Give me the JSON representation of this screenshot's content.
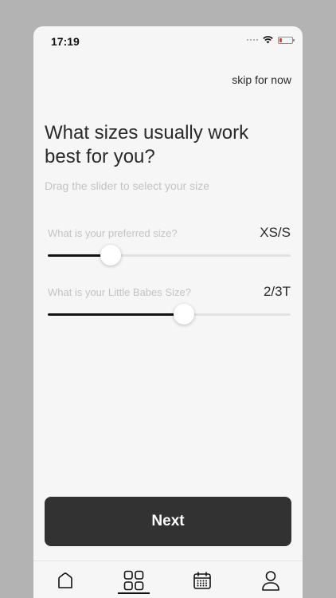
{
  "status_bar": {
    "time": "17:19",
    "battery_level": 0.2,
    "battery_color": "#e53935"
  },
  "header": {
    "skip_label": "skip for now"
  },
  "main": {
    "title": "What sizes usually work best for you?",
    "subtitle": "Drag the slider to select your size"
  },
  "sliders": [
    {
      "label": "What is your preferred size?",
      "value": "XS/S",
      "level": 0.26
    },
    {
      "label": "What is your Little Babes Size?",
      "value": "2/3T",
      "level": 0.56
    }
  ],
  "actions": {
    "next_label": "Next",
    "next_color": "#323232"
  },
  "tab_bar": {
    "items": [
      {
        "icon": "home-icon",
        "active": false
      },
      {
        "icon": "grid-icon",
        "active": true
      },
      {
        "icon": "calendar-icon",
        "active": false
      },
      {
        "icon": "profile-icon",
        "active": false
      }
    ]
  }
}
